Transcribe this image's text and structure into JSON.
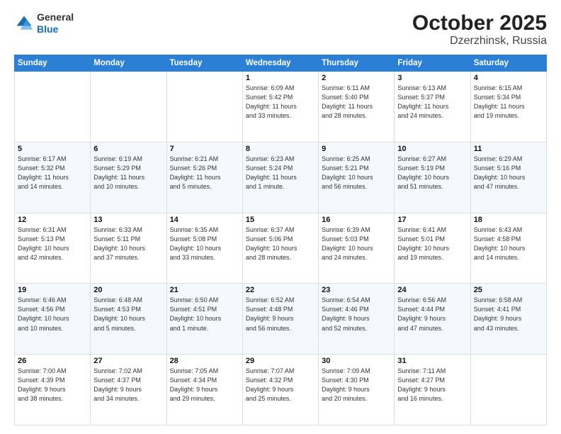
{
  "header": {
    "logo_line1": "General",
    "logo_line2": "Blue",
    "month": "October 2025",
    "location": "Dzerzhinsk, Russia"
  },
  "weekdays": [
    "Sunday",
    "Monday",
    "Tuesday",
    "Wednesday",
    "Thursday",
    "Friday",
    "Saturday"
  ],
  "weeks": [
    [
      {
        "day": "",
        "info": ""
      },
      {
        "day": "",
        "info": ""
      },
      {
        "day": "",
        "info": ""
      },
      {
        "day": "1",
        "info": "Sunrise: 6:09 AM\nSunset: 5:42 PM\nDaylight: 11 hours\nand 33 minutes."
      },
      {
        "day": "2",
        "info": "Sunrise: 6:11 AM\nSunset: 5:40 PM\nDaylight: 11 hours\nand 28 minutes."
      },
      {
        "day": "3",
        "info": "Sunrise: 6:13 AM\nSunset: 5:37 PM\nDaylight: 11 hours\nand 24 minutes."
      },
      {
        "day": "4",
        "info": "Sunrise: 6:15 AM\nSunset: 5:34 PM\nDaylight: 11 hours\nand 19 minutes."
      }
    ],
    [
      {
        "day": "5",
        "info": "Sunrise: 6:17 AM\nSunset: 5:32 PM\nDaylight: 11 hours\nand 14 minutes."
      },
      {
        "day": "6",
        "info": "Sunrise: 6:19 AM\nSunset: 5:29 PM\nDaylight: 11 hours\nand 10 minutes."
      },
      {
        "day": "7",
        "info": "Sunrise: 6:21 AM\nSunset: 5:26 PM\nDaylight: 11 hours\nand 5 minutes."
      },
      {
        "day": "8",
        "info": "Sunrise: 6:23 AM\nSunset: 5:24 PM\nDaylight: 11 hours\nand 1 minute."
      },
      {
        "day": "9",
        "info": "Sunrise: 6:25 AM\nSunset: 5:21 PM\nDaylight: 10 hours\nand 56 minutes."
      },
      {
        "day": "10",
        "info": "Sunrise: 6:27 AM\nSunset: 5:19 PM\nDaylight: 10 hours\nand 51 minutes."
      },
      {
        "day": "11",
        "info": "Sunrise: 6:29 AM\nSunset: 5:16 PM\nDaylight: 10 hours\nand 47 minutes."
      }
    ],
    [
      {
        "day": "12",
        "info": "Sunrise: 6:31 AM\nSunset: 5:13 PM\nDaylight: 10 hours\nand 42 minutes."
      },
      {
        "day": "13",
        "info": "Sunrise: 6:33 AM\nSunset: 5:11 PM\nDaylight: 10 hours\nand 37 minutes."
      },
      {
        "day": "14",
        "info": "Sunrise: 6:35 AM\nSunset: 5:08 PM\nDaylight: 10 hours\nand 33 minutes."
      },
      {
        "day": "15",
        "info": "Sunrise: 6:37 AM\nSunset: 5:06 PM\nDaylight: 10 hours\nand 28 minutes."
      },
      {
        "day": "16",
        "info": "Sunrise: 6:39 AM\nSunset: 5:03 PM\nDaylight: 10 hours\nand 24 minutes."
      },
      {
        "day": "17",
        "info": "Sunrise: 6:41 AM\nSunset: 5:01 PM\nDaylight: 10 hours\nand 19 minutes."
      },
      {
        "day": "18",
        "info": "Sunrise: 6:43 AM\nSunset: 4:58 PM\nDaylight: 10 hours\nand 14 minutes."
      }
    ],
    [
      {
        "day": "19",
        "info": "Sunrise: 6:46 AM\nSunset: 4:56 PM\nDaylight: 10 hours\nand 10 minutes."
      },
      {
        "day": "20",
        "info": "Sunrise: 6:48 AM\nSunset: 4:53 PM\nDaylight: 10 hours\nand 5 minutes."
      },
      {
        "day": "21",
        "info": "Sunrise: 6:50 AM\nSunset: 4:51 PM\nDaylight: 10 hours\nand 1 minute."
      },
      {
        "day": "22",
        "info": "Sunrise: 6:52 AM\nSunset: 4:48 PM\nDaylight: 9 hours\nand 56 minutes."
      },
      {
        "day": "23",
        "info": "Sunrise: 6:54 AM\nSunset: 4:46 PM\nDaylight: 9 hours\nand 52 minutes."
      },
      {
        "day": "24",
        "info": "Sunrise: 6:56 AM\nSunset: 4:44 PM\nDaylight: 9 hours\nand 47 minutes."
      },
      {
        "day": "25",
        "info": "Sunrise: 6:58 AM\nSunset: 4:41 PM\nDaylight: 9 hours\nand 43 minutes."
      }
    ],
    [
      {
        "day": "26",
        "info": "Sunrise: 7:00 AM\nSunset: 4:39 PM\nDaylight: 9 hours\nand 38 minutes."
      },
      {
        "day": "27",
        "info": "Sunrise: 7:02 AM\nSunset: 4:37 PM\nDaylight: 9 hours\nand 34 minutes."
      },
      {
        "day": "28",
        "info": "Sunrise: 7:05 AM\nSunset: 4:34 PM\nDaylight: 9 hours\nand 29 minutes."
      },
      {
        "day": "29",
        "info": "Sunrise: 7:07 AM\nSunset: 4:32 PM\nDaylight: 9 hours\nand 25 minutes."
      },
      {
        "day": "30",
        "info": "Sunrise: 7:09 AM\nSunset: 4:30 PM\nDaylight: 9 hours\nand 20 minutes."
      },
      {
        "day": "31",
        "info": "Sunrise: 7:11 AM\nSunset: 4:27 PM\nDaylight: 9 hours\nand 16 minutes."
      },
      {
        "day": "",
        "info": ""
      }
    ]
  ]
}
